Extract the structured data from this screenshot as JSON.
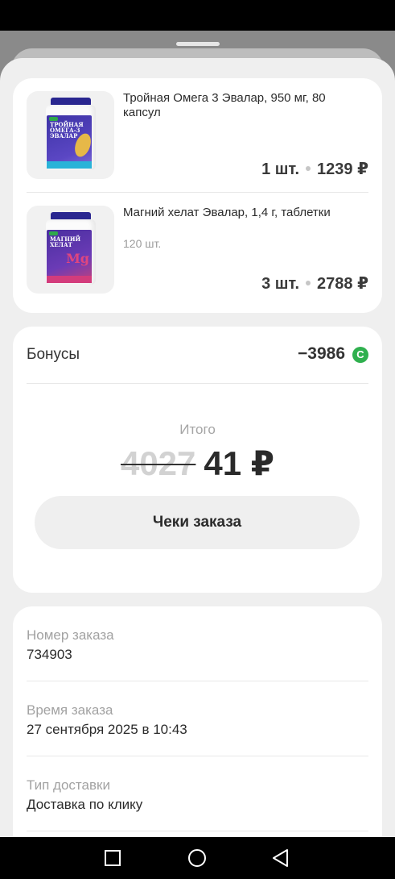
{
  "items": [
    {
      "name": "Тройная Омега 3 Эвалар, 950 мг, 80 капсул",
      "sub": "",
      "qty": "1 шт.",
      "price": "1239 ₽",
      "pack_text": "Тройная Омега-3 Эвалар"
    },
    {
      "name": "Магний хелат Эвалар, 1,4 г, таблетки",
      "sub": "120 шт.",
      "qty": "3 шт.",
      "price": "2788 ₽",
      "pack_text": "Магний хелат",
      "pack_symbol": "Mg"
    }
  ],
  "bonuses": {
    "label": "Бонусы",
    "value": "−3986",
    "icon": "bonus-coin-icon",
    "icon_glyph": "С",
    "icon_color": "#2fb04e"
  },
  "total": {
    "label": "Итого",
    "old": "4027",
    "new": "41 ₽"
  },
  "receipts_button": "Чеки заказа",
  "info": [
    {
      "label": "Номер заказа",
      "value": "734903"
    },
    {
      "label": "Время заказа",
      "value": "27 сентября 2025 в 10:43"
    },
    {
      "label": "Тип доставки",
      "value": "Доставка по клику"
    }
  ],
  "nav": {
    "recent": "recent-apps-icon",
    "home": "home-icon",
    "back": "back-icon"
  }
}
